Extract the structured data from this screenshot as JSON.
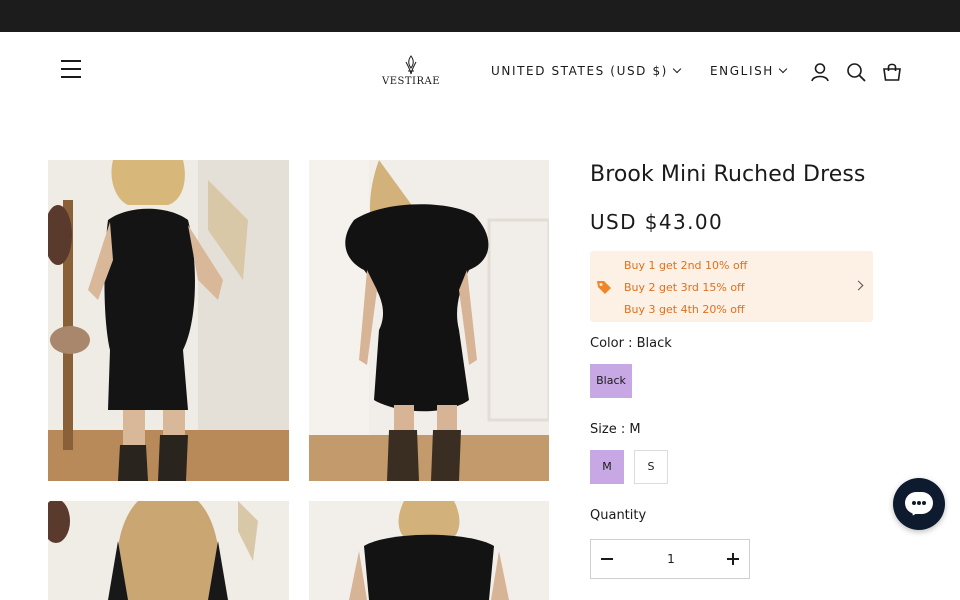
{
  "header": {
    "brand": "VESTIRAE",
    "country_selector": "UNITED STATES (USD $)",
    "language_selector": "ENGLISH",
    "icons": [
      "menu-icon",
      "account-icon",
      "search-icon",
      "cart-icon"
    ]
  },
  "gallery": {
    "images": [
      "model-front-pose",
      "model-front-walk",
      "model-back-hair",
      "model-back-dress"
    ]
  },
  "product": {
    "title": "Brook Mini Ruched Dress",
    "price": "USD $43.00",
    "promotions": [
      "Buy 1 get 2nd 10% off",
      "Buy 2 get 3rd 15% off",
      "Buy 3 get 4th 20% off"
    ],
    "color_label": "Color : Black",
    "colors": [
      "Black"
    ],
    "selected_color": "Black",
    "size_label": "Size : M",
    "sizes": [
      "M",
      "S"
    ],
    "selected_size": "M",
    "quantity_label": "Quantity",
    "quantity_value": "1"
  },
  "colors": {
    "topbar": "#1c1c1c",
    "promo_bg": "#fdf1e6",
    "promo_text": "#e0701e",
    "selected_swatch": "#c7a8e4",
    "chat_button": "#0e1a2e"
  }
}
